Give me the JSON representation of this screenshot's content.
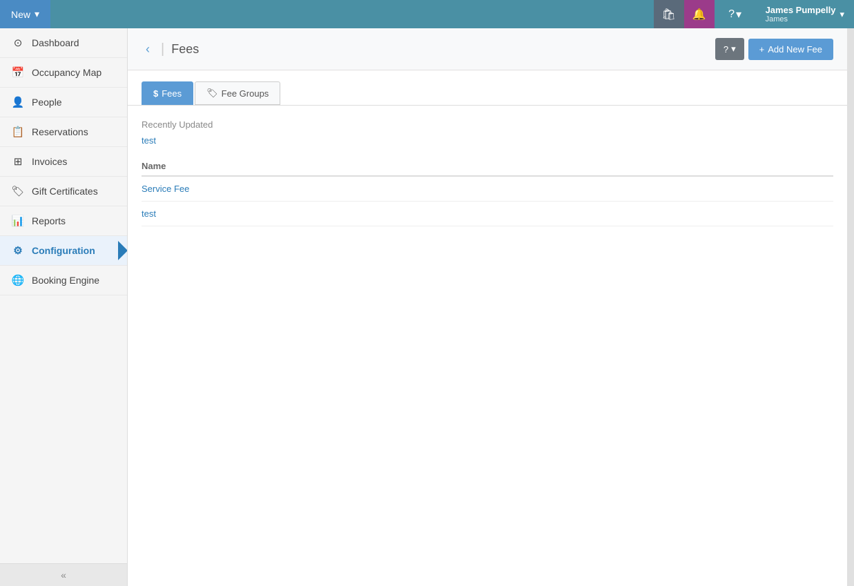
{
  "topnav": {
    "new_label": "New",
    "new_dropdown_icon": "▾",
    "store_icon": "🛍",
    "bell_icon": "🔔",
    "help_label": "?",
    "help_dropdown": "▾",
    "user_fullname": "James Pumpelly",
    "user_shortname": "James",
    "user_dropdown": "▾"
  },
  "sidebar": {
    "items": [
      {
        "id": "dashboard",
        "label": "Dashboard",
        "icon": "⊙"
      },
      {
        "id": "occupancy-map",
        "label": "Occupancy Map",
        "icon": "📅"
      },
      {
        "id": "people",
        "label": "People",
        "icon": "👤"
      },
      {
        "id": "reservations",
        "label": "Reservations",
        "icon": "📋"
      },
      {
        "id": "invoices",
        "label": "Invoices",
        "icon": "⊞"
      },
      {
        "id": "gift-certificates",
        "label": "Gift Certificates",
        "icon": "🏷"
      },
      {
        "id": "reports",
        "label": "Reports",
        "icon": "📊"
      },
      {
        "id": "configuration",
        "label": "Configuration",
        "icon": "⚙"
      },
      {
        "id": "booking-engine",
        "label": "Booking Engine",
        "icon": "🌐"
      }
    ],
    "active": "configuration",
    "collapse_icon": "«"
  },
  "page": {
    "back_icon": "‹",
    "title": "Fees",
    "help_label": "?",
    "add_new_label": "Add New Fee",
    "add_icon": "+"
  },
  "tabs": [
    {
      "id": "fees",
      "label": "Fees",
      "icon": "$",
      "active": true
    },
    {
      "id": "fee-groups",
      "label": "Fee Groups",
      "icon": "🏷",
      "active": false
    }
  ],
  "recently_updated": {
    "label": "Recently Updated",
    "item": "test"
  },
  "table": {
    "column_name": "Name",
    "rows": [
      {
        "name": "Service Fee"
      },
      {
        "name": "test"
      }
    ]
  }
}
